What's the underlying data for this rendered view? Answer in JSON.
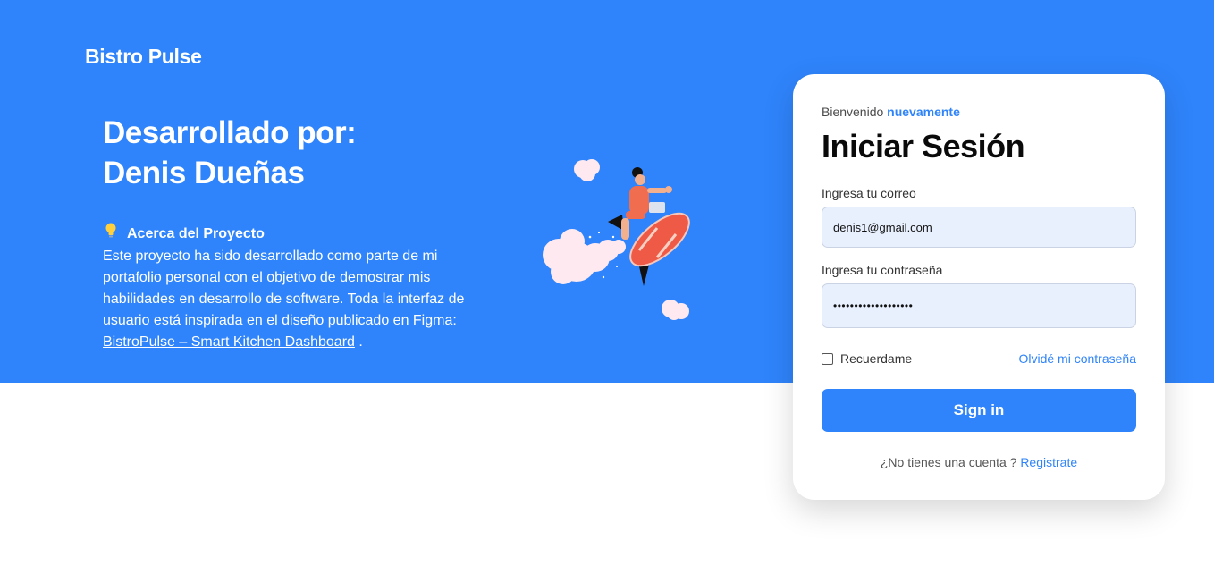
{
  "brand": "Bistro Pulse",
  "hero": {
    "headline_line1": "Desarrollado por:",
    "headline_line2": "Denis Dueñas",
    "about_title": "Acerca del Proyecto",
    "about_text": "Este proyecto ha sido desarrollado como parte de mi portafolio personal con el objetivo de demostrar mis habilidades en desarrollo de software. Toda la interfaz de usuario está inspirada en el diseño publicado en Figma:",
    "about_link": "BistroPulse – Smart Kitchen Dashboard",
    "about_end": "."
  },
  "login": {
    "welcome_prefix": "Bienvenido",
    "welcome_highlight": "nuevamente",
    "title": "Iniciar Sesión",
    "email_label": "Ingresa tu correo",
    "email_value": "denis1@gmail.com",
    "password_label": "Ingresa tu contraseña",
    "password_value": "•••••••••••••••••••",
    "remember_label": "Recuerdame",
    "forgot_label": "Olvidé mi contraseña",
    "sign_in_label": "Sign in",
    "no_account_text": "¿No tienes una cuenta ?",
    "register_label": "Registrate"
  },
  "colors": {
    "primary": "#2f84fb",
    "input_bg": "#e8f0fe",
    "card_bg": "#ffffff"
  },
  "icons": {
    "bulb": "lightbulb-icon",
    "illustration": "rocket-rider-illustration"
  }
}
